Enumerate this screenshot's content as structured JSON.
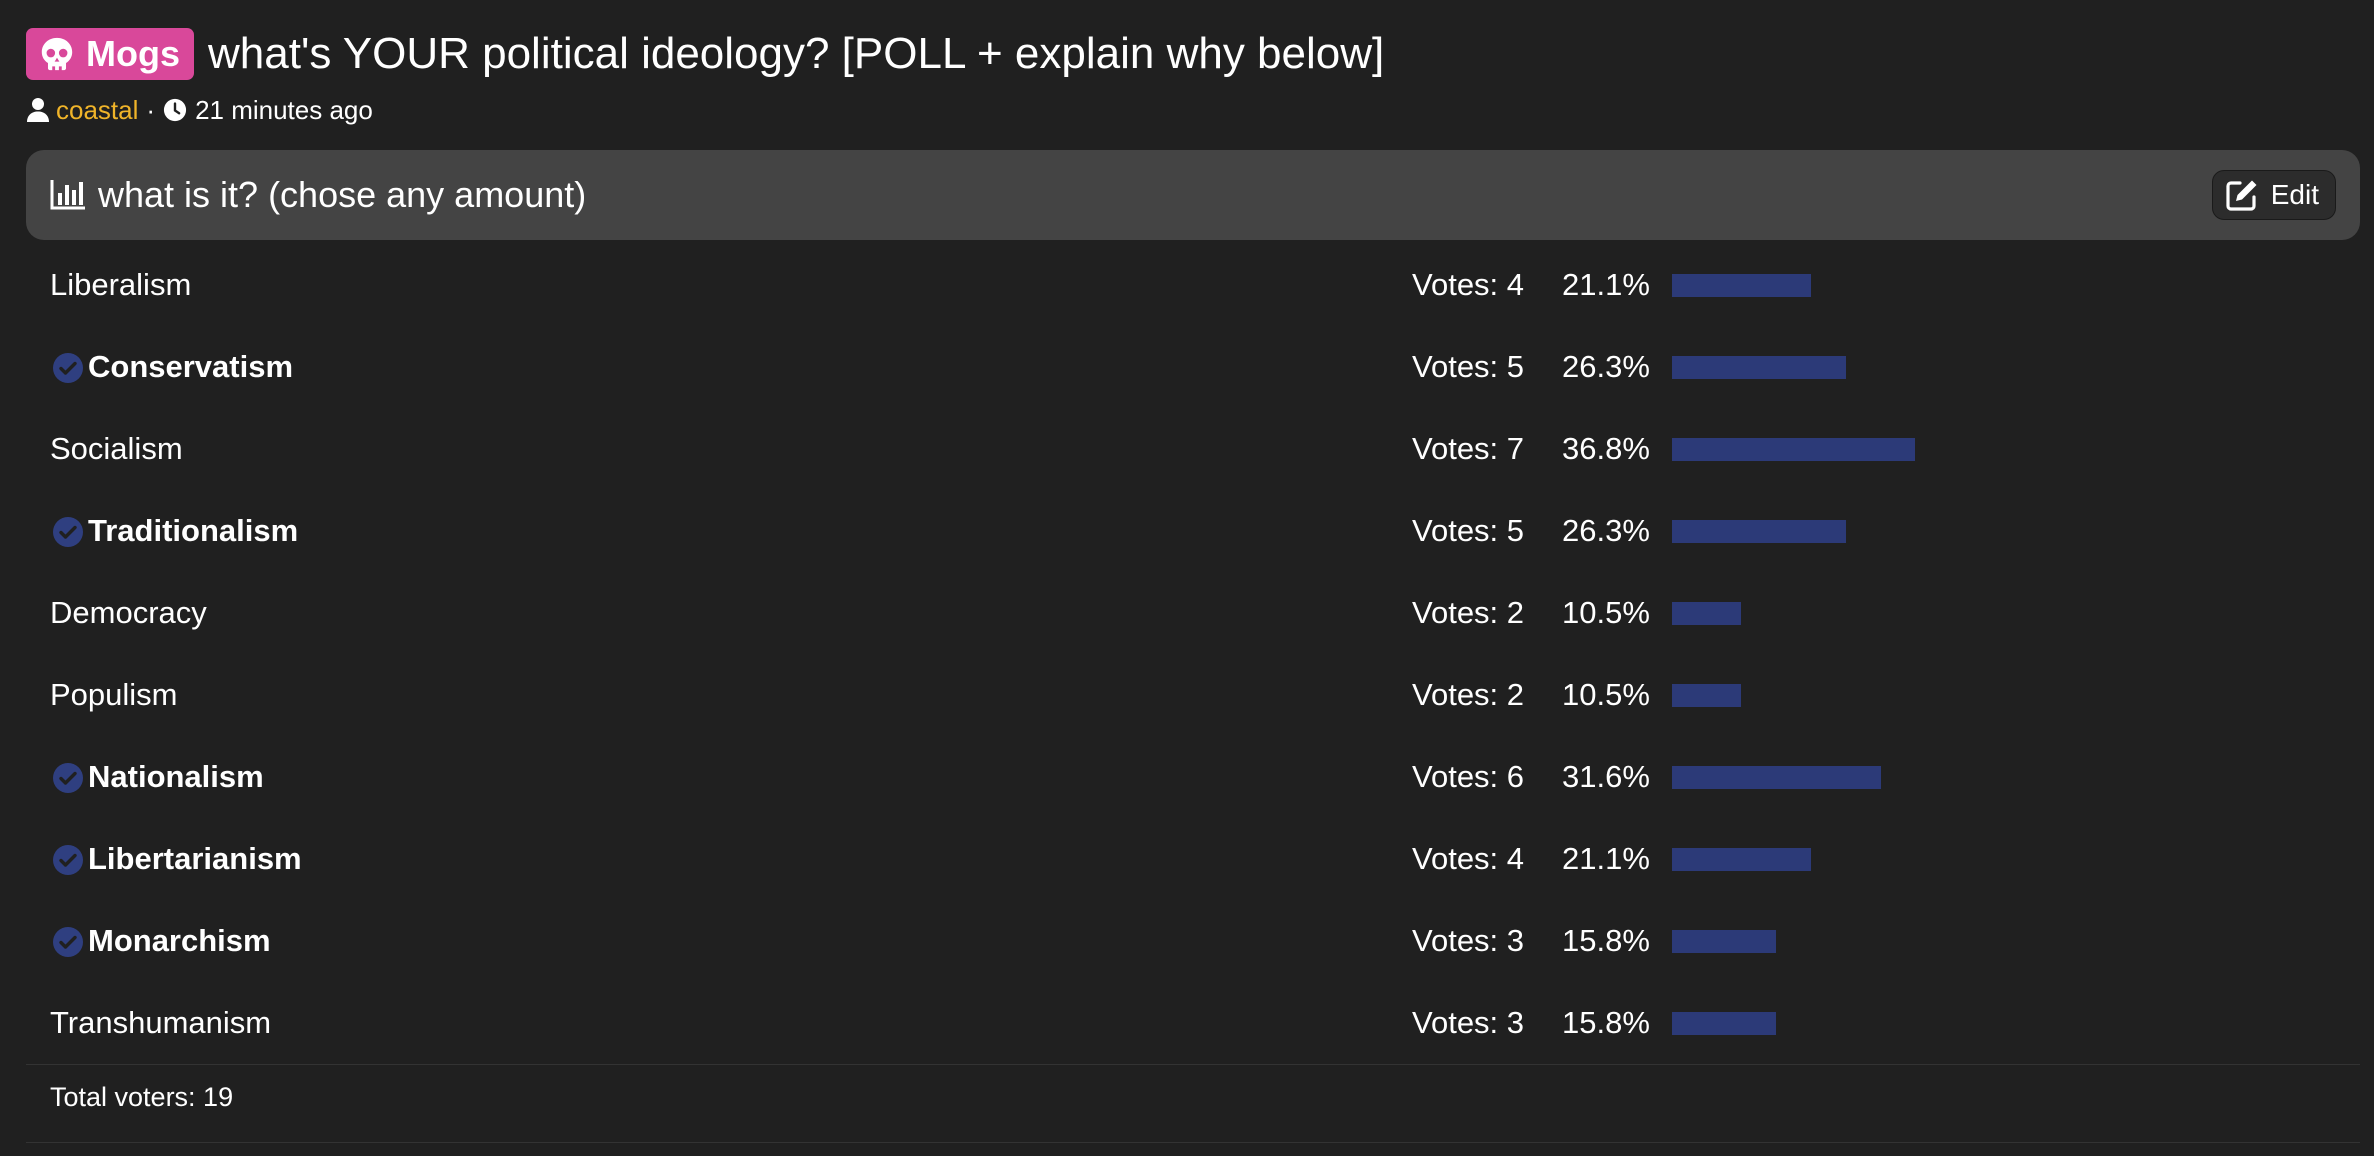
{
  "post": {
    "community_badge": "Mogs",
    "title": "what's YOUR political ideology? [POLL + explain why below]",
    "author": "coastal",
    "separator": "·",
    "time": "21 minutes ago"
  },
  "poll": {
    "question": "what is it? (chose any amount)",
    "edit_label": "Edit",
    "options": [
      {
        "label": "Liberalism",
        "votes": "Votes: 4",
        "percent": "21.1%",
        "fraction": 0.211,
        "selected": false
      },
      {
        "label": "Conservatism",
        "votes": "Votes: 5",
        "percent": "26.3%",
        "fraction": 0.263,
        "selected": true
      },
      {
        "label": "Socialism",
        "votes": "Votes: 7",
        "percent": "36.8%",
        "fraction": 0.368,
        "selected": false
      },
      {
        "label": "Traditionalism",
        "votes": "Votes: 5",
        "percent": "26.3%",
        "fraction": 0.263,
        "selected": true
      },
      {
        "label": "Democracy",
        "votes": "Votes: 2",
        "percent": "10.5%",
        "fraction": 0.105,
        "selected": false
      },
      {
        "label": "Populism",
        "votes": "Votes: 2",
        "percent": "10.5%",
        "fraction": 0.105,
        "selected": false
      },
      {
        "label": "Nationalism",
        "votes": "Votes: 6",
        "percent": "31.6%",
        "fraction": 0.316,
        "selected": true
      },
      {
        "label": "Libertarianism",
        "votes": "Votes: 4",
        "percent": "21.1%",
        "fraction": 0.211,
        "selected": true
      },
      {
        "label": "Monarchism",
        "votes": "Votes: 3",
        "percent": "15.8%",
        "fraction": 0.158,
        "selected": true
      },
      {
        "label": "Transhumanism",
        "votes": "Votes: 3",
        "percent": "15.8%",
        "fraction": 0.158,
        "selected": false
      }
    ],
    "total_voters": "Total voters: 19"
  },
  "colors": {
    "badge": "#d9489a",
    "author": "#f0b429",
    "bar": "#2c3a78",
    "check": "#2f3f80",
    "header_bg": "#444444",
    "page_bg": "#202020"
  },
  "icons": {
    "badge": "skull-icon",
    "author": "user-icon",
    "time": "clock-icon",
    "poll": "bar-chart-icon",
    "edit": "edit-icon",
    "selected": "check-circle-icon"
  }
}
